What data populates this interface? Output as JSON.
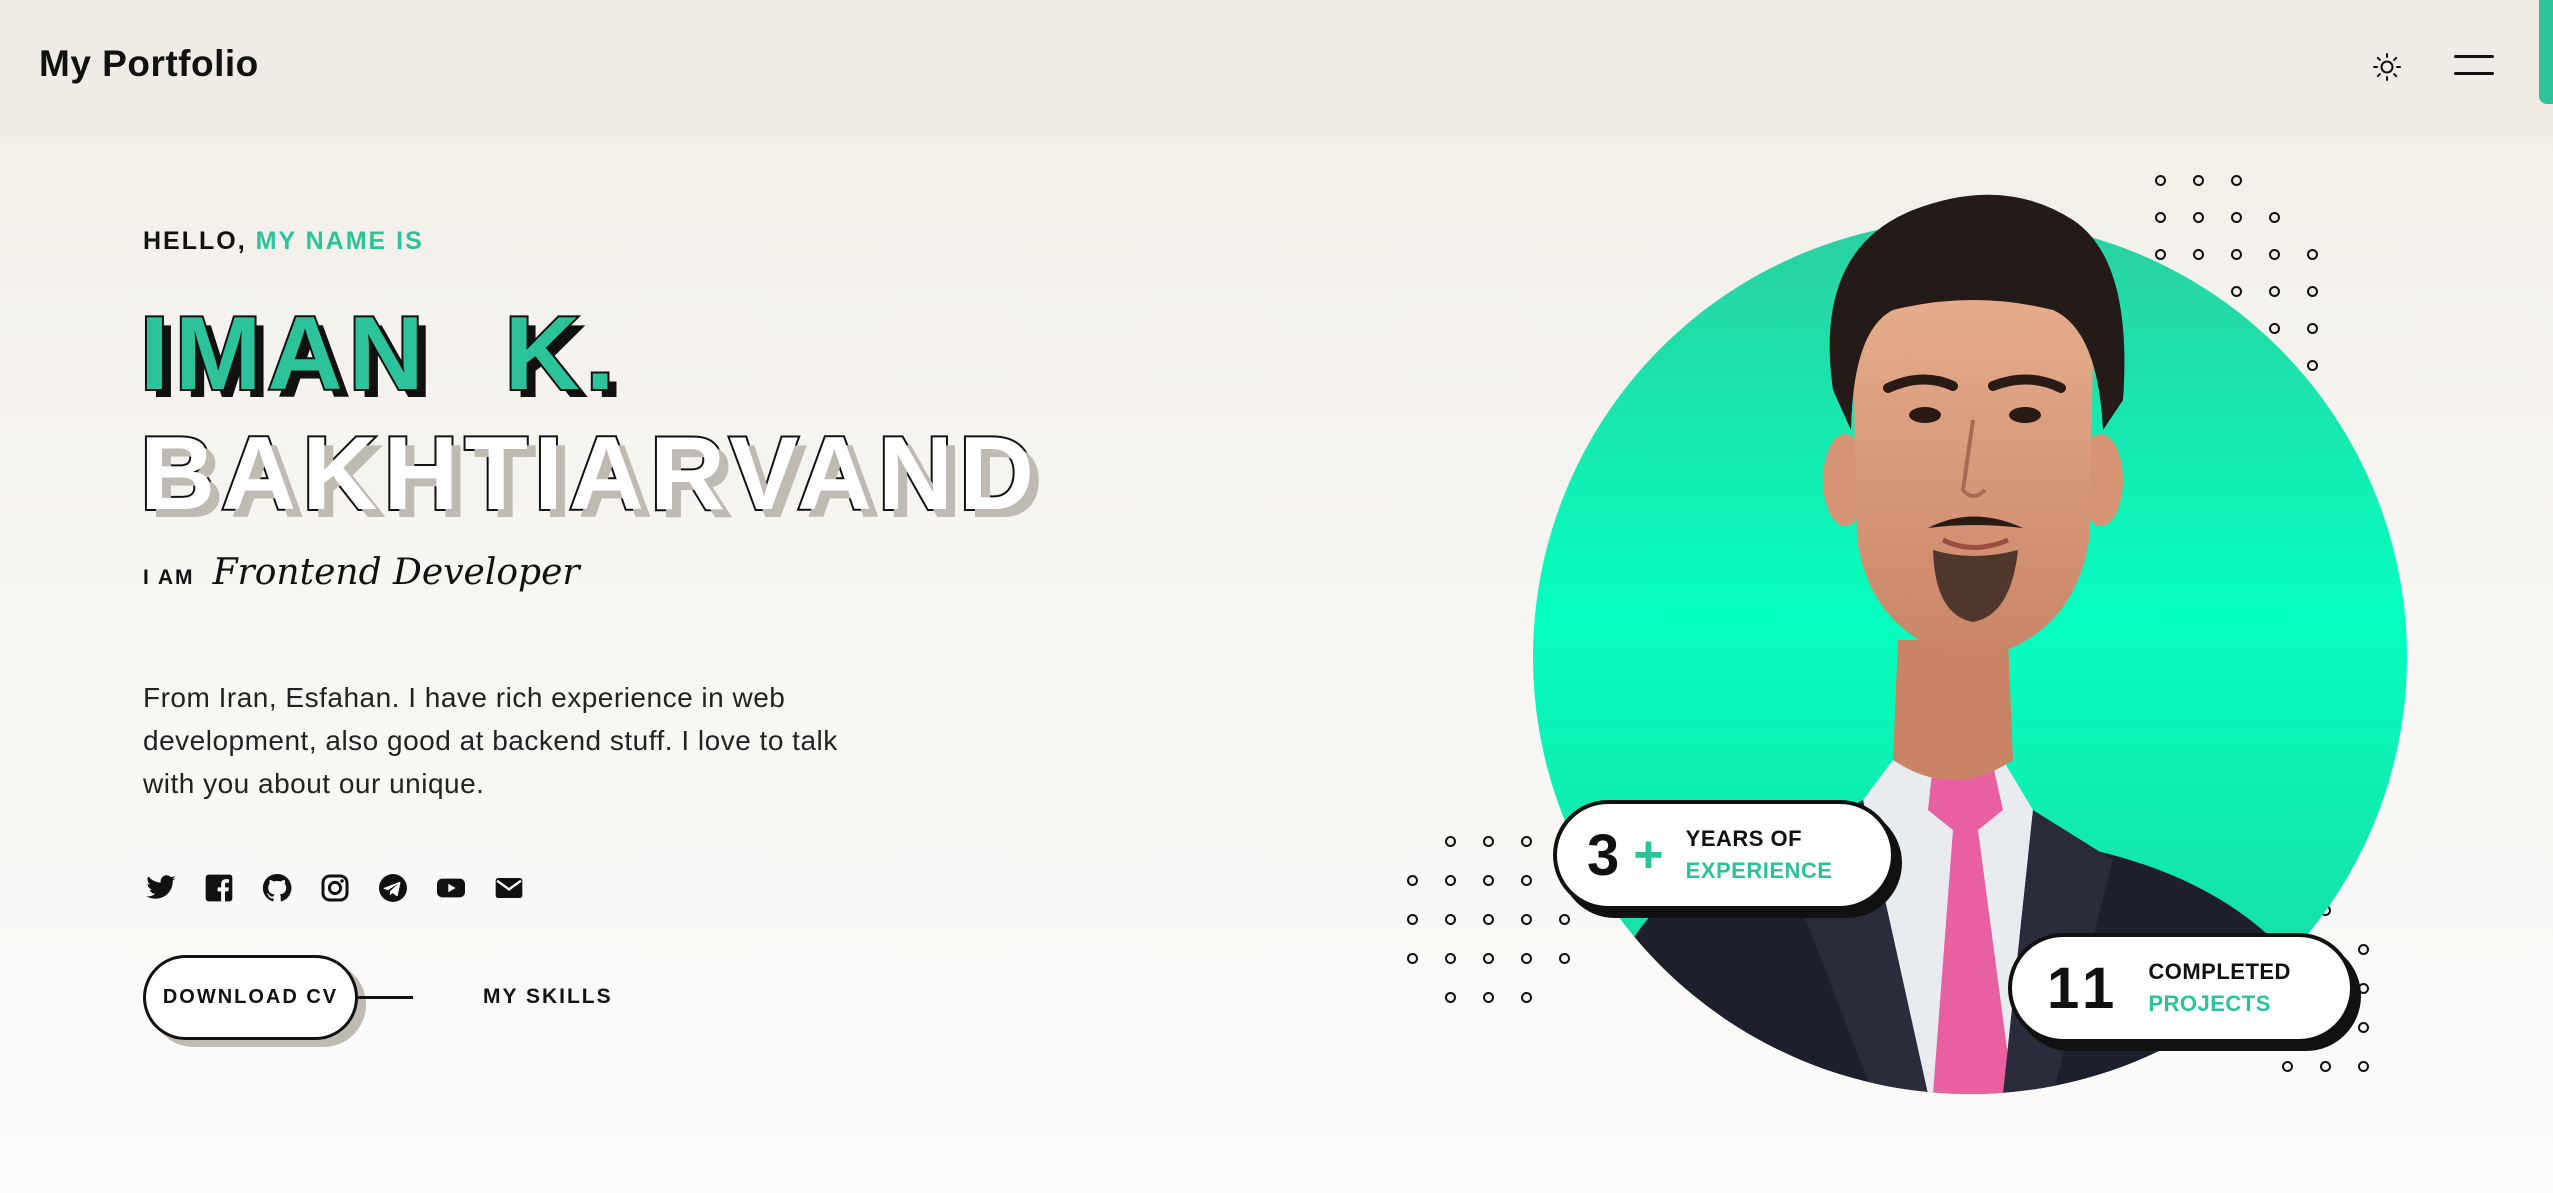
{
  "header": {
    "brand": "My Portfolio",
    "theme_toggle_icon": "sun-icon",
    "menu_icon": "hamburger-menu-icon"
  },
  "hero": {
    "greeting_prefix": "HELLO,",
    "greeting_accent": "MY NAME IS",
    "name_line_1": "IMAN K.",
    "name_line_2": "BAKHTIARVAND",
    "role_prefix": "I AM",
    "role_title": "Frontend Developer",
    "bio": "From Iran, Esfahan. I have rich experience in web development, also good at backend stuff. I love to talk with you about our unique.",
    "socials": [
      "twitter-icon",
      "facebook-icon",
      "github-icon",
      "instagram-icon",
      "telegram-icon",
      "youtube-icon",
      "email-icon"
    ],
    "download_cv_label": "DOWNLOAD CV",
    "skills_label": "MY SKILLS"
  },
  "stats": {
    "experience": {
      "number": "3",
      "plus": "+",
      "line1": "YEARS OF",
      "line2": "EXPERIENCE"
    },
    "projects": {
      "number": "11",
      "line1": "COMPLETED",
      "line2": "PROJECTS"
    }
  },
  "colors": {
    "accent": "#2cc39b",
    "ink": "#111111",
    "background": "#f1ede6"
  }
}
